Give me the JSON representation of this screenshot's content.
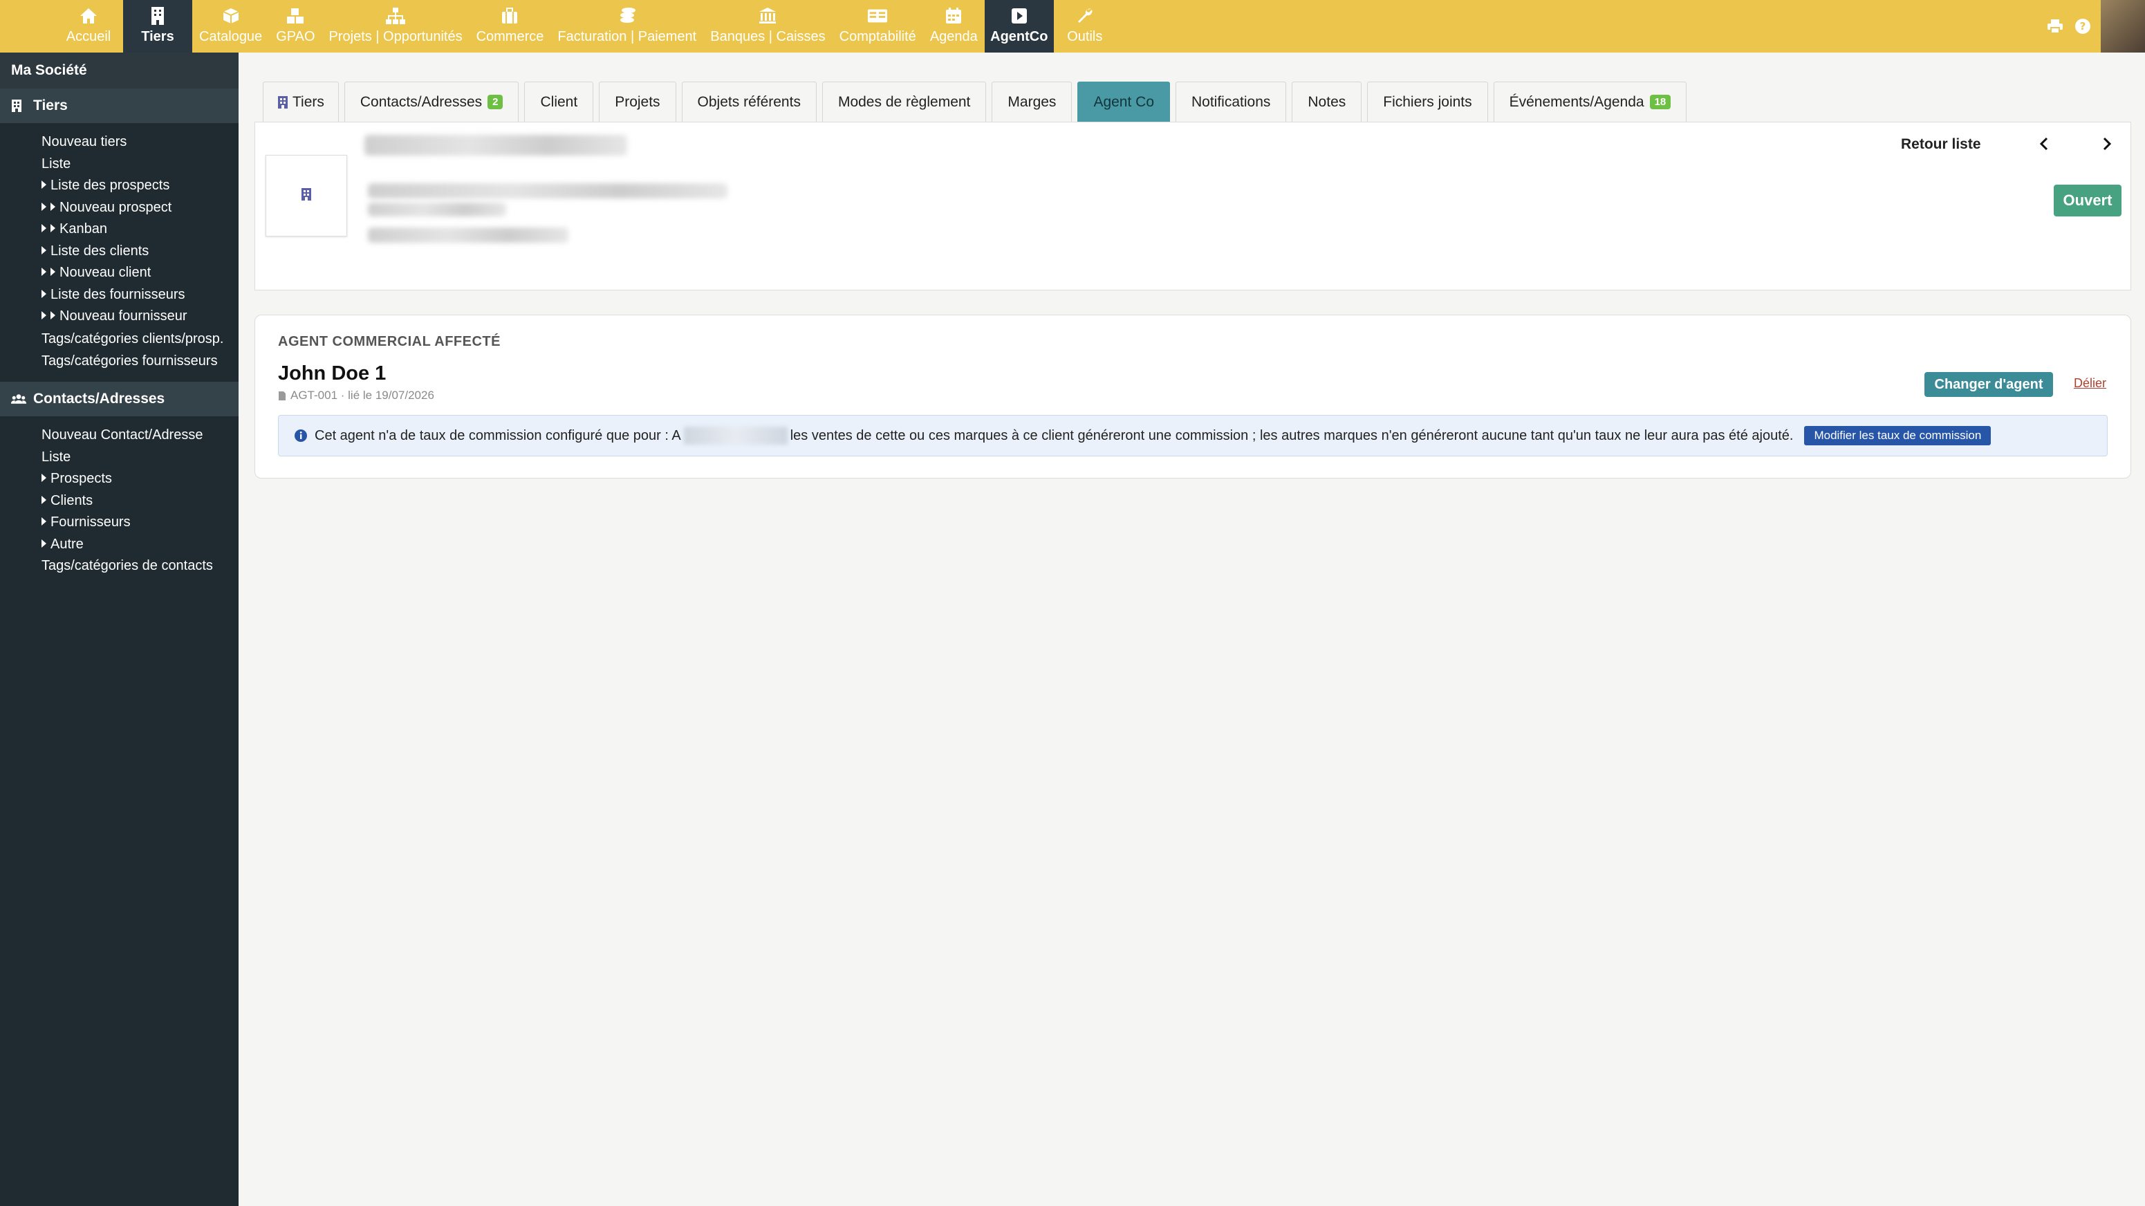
{
  "topnav": {
    "items": [
      {
        "label": "Accueil",
        "icon": "home-icon"
      },
      {
        "label": "Tiers",
        "icon": "building-icon"
      },
      {
        "label": "Catalogue",
        "icon": "box-icon"
      },
      {
        "label": "GPAO",
        "icon": "cubes-icon"
      },
      {
        "label": "Projets | Opportunités",
        "icon": "sitemap-icon"
      },
      {
        "label": "Commerce",
        "icon": "suitcase-icon"
      },
      {
        "label": "Facturation | Paiement",
        "icon": "coins-icon"
      },
      {
        "label": "Banques | Caisses",
        "icon": "bank-icon"
      },
      {
        "label": "Comptabilité",
        "icon": "ledger-icon"
      },
      {
        "label": "Agenda",
        "icon": "calendar-icon"
      },
      {
        "label": "AgentCo",
        "icon": "play-square-icon"
      },
      {
        "label": "Outils",
        "icon": "wrench-icon"
      }
    ],
    "active": "Tiers"
  },
  "sidebar": {
    "company": "Ma Société",
    "sections": [
      {
        "title": "Tiers",
        "icon": "building-icon",
        "items": [
          {
            "label": "Nouveau tiers"
          },
          {
            "label": "Liste"
          },
          {
            "label": "Liste des prospects"
          },
          {
            "label": "Nouveau prospect"
          },
          {
            "label": "Kanban"
          },
          {
            "label": "Liste des clients"
          },
          {
            "label": "Nouveau client"
          },
          {
            "label": "Liste des fournisseurs"
          },
          {
            "label": "Nouveau fournisseur"
          },
          {
            "label": "Tags/catégories clients/prosp."
          },
          {
            "label": "Tags/catégories fournisseurs"
          }
        ]
      },
      {
        "title": "Contacts/Adresses",
        "icon": "users-icon",
        "items": [
          {
            "label": "Nouveau Contact/Adresse"
          },
          {
            "label": "Liste"
          },
          {
            "label": "Prospects"
          },
          {
            "label": "Clients"
          },
          {
            "label": "Fournisseurs"
          },
          {
            "label": "Autre"
          },
          {
            "label": "Tags/catégories de contacts"
          }
        ]
      }
    ]
  },
  "tabs": [
    {
      "label": "Tiers"
    },
    {
      "label": "Contacts/Adresses",
      "badge": "2"
    },
    {
      "label": "Client"
    },
    {
      "label": "Projets"
    },
    {
      "label": "Objets référents"
    },
    {
      "label": "Modes de règlement"
    },
    {
      "label": "Marges"
    },
    {
      "label": "Agent Co"
    },
    {
      "label": "Notifications"
    },
    {
      "label": "Notes"
    },
    {
      "label": "Fichiers joints"
    },
    {
      "label": "Événements/Agenda",
      "badge": "18"
    }
  ],
  "header": {
    "back_label": "Retour liste",
    "status": "Ouvert"
  },
  "agent": {
    "section_title": "AGENT COMMERCIAL AFFECTÉ",
    "name": "John Doe 1",
    "meta": "AGT-001 · lié le 19/07/2026",
    "change_button": "Changer d'agent",
    "unlink": "Délier",
    "info_prefix": "Cet agent n'a de taux de commission configuré que pour : A",
    "info_suffix": " les ventes de cette ou ces marques à ce client généreront une commission ; les autres marques n'en généreront aucune tant qu'un taux ne leur aura pas été ajouté.",
    "modify_button": "Modifier les taux de commission"
  },
  "colors": {
    "topbar": "#ecc64c",
    "sidebar": "#1f2b30",
    "active_tab": "#4a9aa5",
    "status_green": "#47a282",
    "badge_green": "#6ec044"
  }
}
